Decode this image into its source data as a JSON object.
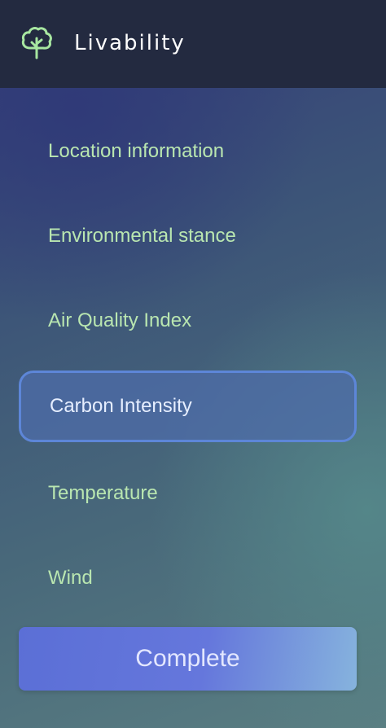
{
  "header": {
    "title": "Livability",
    "logo_icon": "tree-icon",
    "icon_color": "#a7e6a0"
  },
  "menu": {
    "items": [
      {
        "label": "Location information",
        "active": false
      },
      {
        "label": "Environmental stance",
        "active": false
      },
      {
        "label": "Air Quality Index",
        "active": false
      },
      {
        "label": "Carbon Intensity",
        "active": true
      },
      {
        "label": "Temperature",
        "active": false
      },
      {
        "label": "Wind",
        "active": false
      }
    ]
  },
  "footer": {
    "complete_label": "Complete"
  },
  "colors": {
    "header_bg": "#232a40",
    "menu_text": "#b9e6b0",
    "active_border": "#5d86d8",
    "button_start": "#5b6fd6",
    "button_end": "#86b3dd"
  }
}
